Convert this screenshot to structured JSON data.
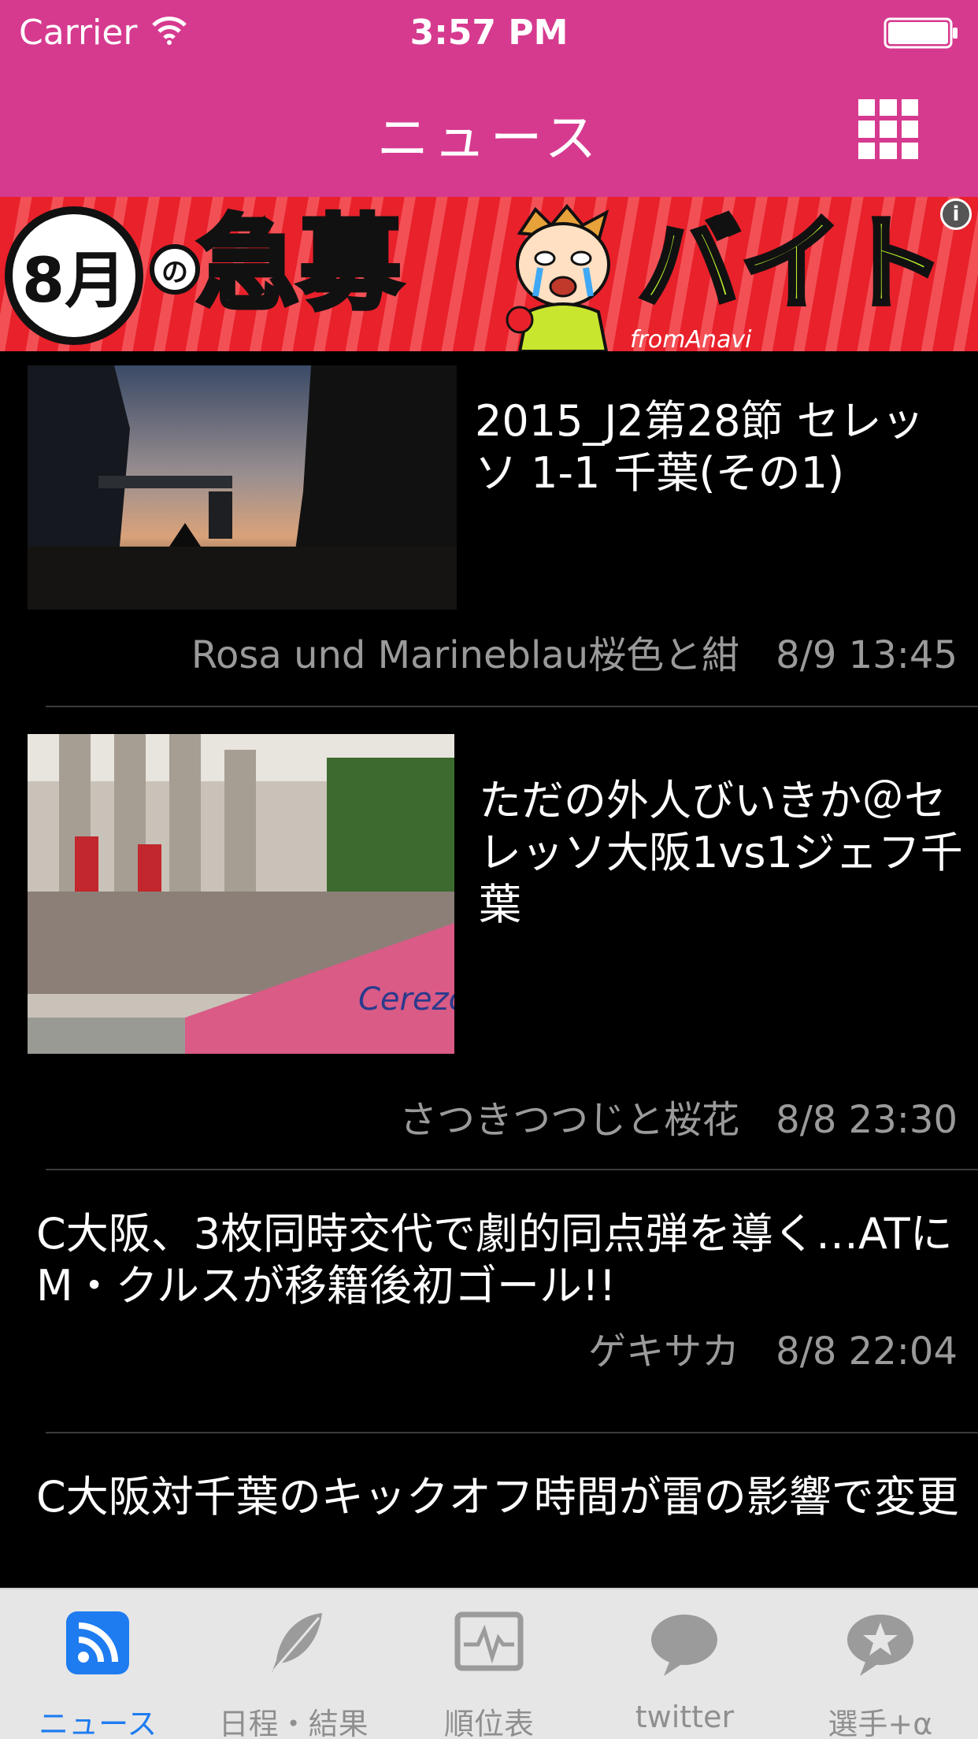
{
  "status_bar": {
    "carrier": "Carrier",
    "time": "3:57 PM"
  },
  "nav": {
    "title": "ニュース"
  },
  "banner": {
    "badge": "8月",
    "particle": "の",
    "word_left": "急募",
    "word_right": "バイト",
    "brand": "fromAnavi",
    "info": "i"
  },
  "feed": {
    "items": [
      {
        "title": "2015_J2第28節 セレッソ 1-1 千葉(その1)",
        "source": "Rosa und Marineblau桜色と紺",
        "date": "8/9 13:45"
      },
      {
        "title": "ただの外人びいきか＠セレッソ大阪1vs1ジェフ千葉",
        "source": "さつきつつじと桜花",
        "date": "8/8 23:30"
      },
      {
        "title": "C大阪、3枚同時交代で劇的同点弾を導く…ATにM・クルスが移籍後初ゴール!!",
        "source": "ゲキサカ",
        "date": "8/8 22:04"
      },
      {
        "title": "C大阪対千葉のキックオフ時間が雷の影響で変更"
      }
    ]
  },
  "tabbar": {
    "tabs": [
      {
        "label": "ニュース",
        "icon": "rss-icon",
        "active": true
      },
      {
        "label": "日程・結果",
        "icon": "feather-icon"
      },
      {
        "label": "順位表",
        "icon": "chart-monitor-icon"
      },
      {
        "label": "twitter",
        "icon": "speech-bubble-icon"
      },
      {
        "label": "選手+α",
        "icon": "star-bubble-icon"
      }
    ]
  },
  "colors": {
    "header": "#d63a8f",
    "accent": "#1e7cf0",
    "tabbar": "#e6e6e6"
  }
}
